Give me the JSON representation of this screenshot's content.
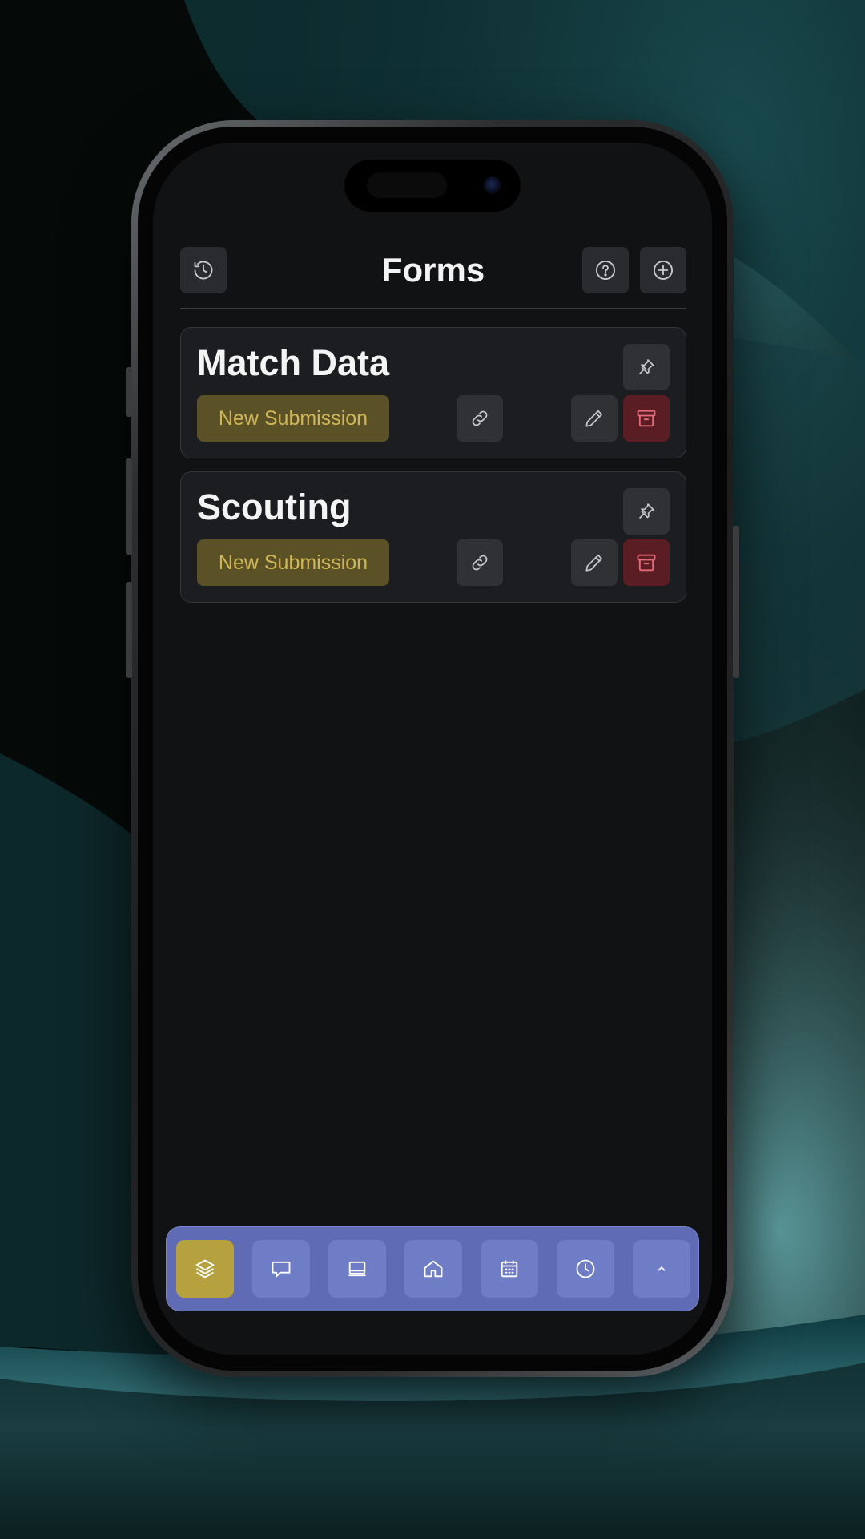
{
  "header": {
    "title": "Forms",
    "history_icon": "history-icon",
    "help_icon": "help-circle-icon",
    "add_icon": "plus-circle-icon"
  },
  "forms": [
    {
      "title": "Match Data",
      "submit_label": "New Submission",
      "icons": [
        "pin-icon",
        "link-icon",
        "pencil-icon",
        "archive-icon"
      ]
    },
    {
      "title": "Scouting",
      "submit_label": "New Submission",
      "icons": [
        "pin-icon",
        "link-icon",
        "pencil-icon",
        "archive-icon"
      ]
    }
  ],
  "bottom_nav": {
    "items": [
      {
        "icon": "layers-icon",
        "active": true
      },
      {
        "icon": "message-icon",
        "active": false
      },
      {
        "icon": "tablet-icon",
        "active": false
      },
      {
        "icon": "home-icon",
        "active": false
      },
      {
        "icon": "calendar-icon",
        "active": false
      },
      {
        "icon": "clock-icon",
        "active": false
      },
      {
        "icon": "chevron-up-icon",
        "active": false
      }
    ]
  },
  "colors": {
    "background": "#111214",
    "card": "#1b1d20",
    "accent_yellow": "#b5a23f",
    "submit_text": "#cfb657",
    "danger": "#5a1d24",
    "nav": "#5f6bb5"
  }
}
